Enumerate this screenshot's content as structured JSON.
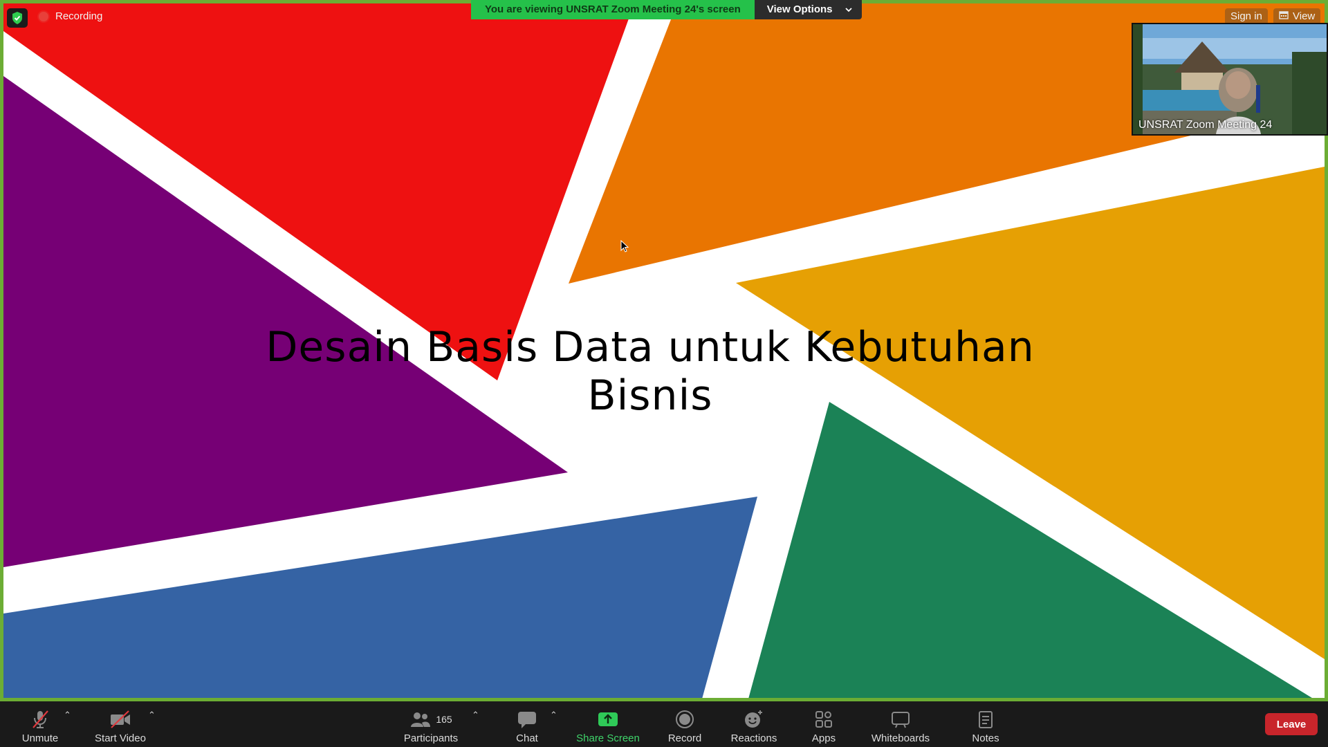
{
  "recording": {
    "label": "Recording"
  },
  "share_banner": {
    "text": "You are viewing UNSRAT Zoom Meeting 24's screen",
    "view_options_label": "View Options"
  },
  "top_right": {
    "sign_in_label": "Sign in",
    "view_label": "View"
  },
  "video_thumbnail": {
    "name": "UNSRAT Zoom Meeting 24"
  },
  "slide": {
    "title_line1": "Desain Basis Data untuk Kebutuhan",
    "title_line2": "Bisnis",
    "colors": {
      "red": "#ee1111",
      "orange": "#e97501",
      "purple": "#760075",
      "gold": "#e6a004",
      "blue": "#3563a4",
      "green": "#1b8256"
    }
  },
  "toolbar": {
    "unmute_label": "Unmute",
    "start_video_label": "Start Video",
    "participants_label": "Participants",
    "participants_count": "165",
    "chat_label": "Chat",
    "share_screen_label": "Share Screen",
    "record_label": "Record",
    "reactions_label": "Reactions",
    "apps_label": "Apps",
    "whiteboards_label": "Whiteboards",
    "notes_label": "Notes",
    "leave_label": "Leave"
  },
  "icons": {
    "shield": "shield-check-icon",
    "recording": "record-dot-icon",
    "chevron": "chevron-down-icon",
    "calendar": "calendar-grid-icon",
    "mic": "microphone-muted-icon",
    "video": "camera-off-icon",
    "participants": "people-icon",
    "chat": "chat-bubble-icon",
    "share": "share-arrow-up-icon",
    "record": "record-circle-icon",
    "reactions": "smiley-plus-icon",
    "apps": "apps-grid-icon",
    "whiteboards": "whiteboard-icon",
    "notes": "notes-icon",
    "cursor": "mouse-pointer-icon"
  }
}
